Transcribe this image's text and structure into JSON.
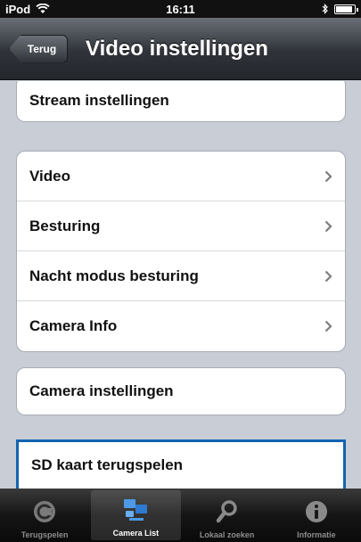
{
  "status_bar": {
    "carrier": "iPod",
    "time": "16:11",
    "battery_level": 0.9
  },
  "nav": {
    "back_label": "Terug",
    "title": "Video instellingen"
  },
  "groups": {
    "stream": {
      "label": "Stream instellingen"
    },
    "main": [
      {
        "label": "Video"
      },
      {
        "label": "Besturing"
      },
      {
        "label": "Nacht modus besturing"
      },
      {
        "label": "Camera Info"
      }
    ],
    "camera": {
      "label": "Camera instellingen"
    },
    "sd": {
      "label": "SD kaart terugspelen"
    }
  },
  "tabs": [
    {
      "label": "Terugspelen",
      "icon": "playback-icon"
    },
    {
      "label": "Camera List",
      "icon": "camera-list-icon",
      "active": true
    },
    {
      "label": "Lokaal zoeken",
      "icon": "search-icon"
    },
    {
      "label": "Informatie",
      "icon": "info-icon"
    }
  ],
  "colors": {
    "highlight_border": "#1563ae",
    "background": "#c9ced6"
  }
}
